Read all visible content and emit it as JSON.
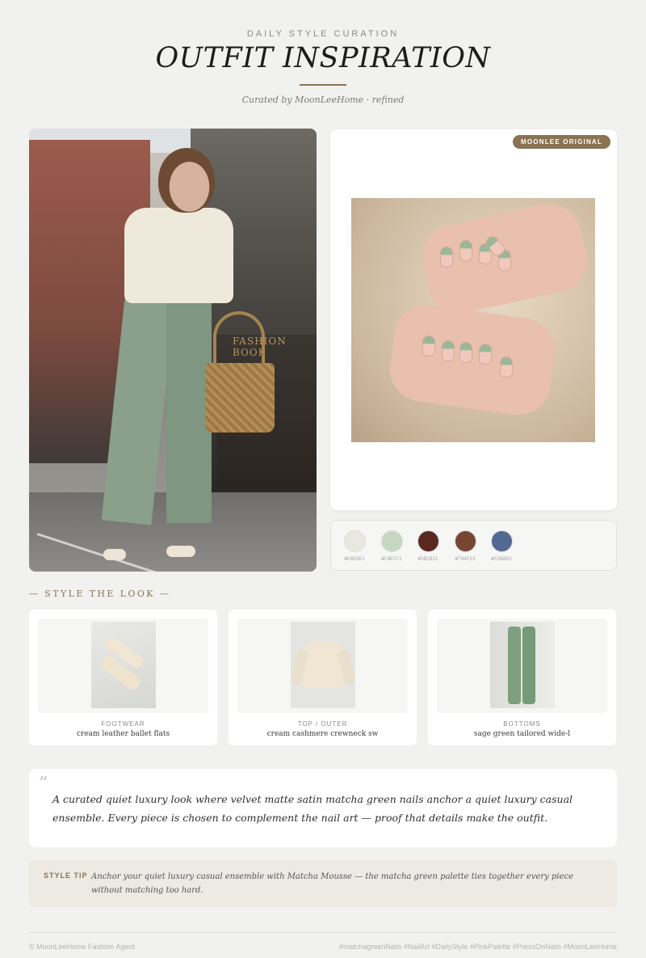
{
  "header": {
    "kicker": "DAILY STYLE CURATION",
    "title": "OUTFIT INSPIRATION",
    "byline": "Curated by MoonLeeHome · refined"
  },
  "hero": {
    "sign_text": "FASHION BOOK"
  },
  "nail_card": {
    "badge": "MOONLEE ORIGINAL"
  },
  "palette": {
    "swatches": [
      {
        "color": "#E8E8E1",
        "label": "#E8E8E1"
      },
      {
        "color": "#C4D7C1",
        "label": "#C4D7C1"
      },
      {
        "color": "#5B2821",
        "label": "#5B2821"
      },
      {
        "color": "#794533",
        "label": "#794533"
      },
      {
        "color": "#536893",
        "label": "#536893"
      }
    ]
  },
  "style_section": {
    "title": "— STYLE THE LOOK —",
    "items": [
      {
        "category": "FOOTWEAR",
        "description": "cream leather ballet flats"
      },
      {
        "category": "TOP / OUTER",
        "description": "cream cashmere crewneck sw"
      },
      {
        "category": "BOTTOMS",
        "description": "sage green tailored wide-l"
      }
    ]
  },
  "quote": {
    "mark": "“",
    "text": "A curated quiet luxury look where velvet matte satin matcha green nails anchor a quiet luxury casual ensemble. Every piece is chosen to complement the nail art — proof that details make the outfit."
  },
  "tip": {
    "label": "STYLE TIP",
    "text": "Anchor your quiet luxury casual ensemble with Matcha Mousse — the matcha green palette ties together every piece without matching too hard."
  },
  "footer": {
    "left": "© MoonLeeHome Fashion Agent",
    "right": "#matchagreenNails #NailArt #DailyStyle #PinkPalette #PressOnNails #MoonLeeHome"
  }
}
